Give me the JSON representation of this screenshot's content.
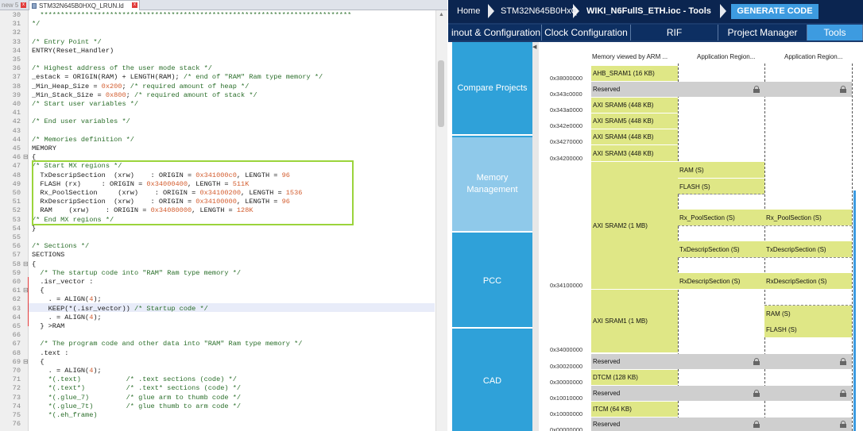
{
  "editor": {
    "prev_tab_label": "new 5",
    "active_tab_label": "STM32N645B0HXQ_LRUN.ld",
    "lines": [
      {
        "n": "30",
        "t": "  ****************************************************************************"
      },
      {
        "n": "31",
        "t": "*/"
      },
      {
        "n": "32",
        "t": ""
      },
      {
        "n": "33",
        "t": "/* Entry Point */"
      },
      {
        "n": "34",
        "t": "ENTRY(Reset_Handler)"
      },
      {
        "n": "35",
        "t": ""
      },
      {
        "n": "36",
        "t": "/* Highest address of the user mode stack */"
      },
      {
        "n": "37",
        "t": "_estack = ORIGIN(RAM) + LENGTH(RAM); /* end of \"RAM\" Ram type memory */"
      },
      {
        "n": "38",
        "t": "_Min_Heap_Size = 0x200; /* required amount of heap */"
      },
      {
        "n": "39",
        "t": "_Min_Stack_Size = 0x800; /* required amount of stack */"
      },
      {
        "n": "40",
        "t": "/* Start user variables */"
      },
      {
        "n": "41",
        "t": ""
      },
      {
        "n": "42",
        "t": "/* End user variables */"
      },
      {
        "n": "43",
        "t": ""
      },
      {
        "n": "44",
        "t": "/* Memories definition */"
      },
      {
        "n": "45",
        "t": "MEMORY"
      },
      {
        "n": "46",
        "t": "{"
      },
      {
        "n": "47",
        "t": "/* Start MX regions */"
      },
      {
        "n": "48",
        "t": "  TxDescripSection  (xrw)    : ORIGIN = 0x341000c0, LENGTH = 96"
      },
      {
        "n": "49",
        "t": "  FLASH (rx)     : ORIGIN = 0x34000400, LENGTH = 511K"
      },
      {
        "n": "50",
        "t": "  Rx_PoolSection     (xrw)    : ORIGIN = 0x34100200, LENGTH = 1536"
      },
      {
        "n": "51",
        "t": "  RxDescripSection  (xrw)    : ORIGIN = 0x34100000, LENGTH = 96"
      },
      {
        "n": "52",
        "t": "  RAM    (xrw)    : ORIGIN = 0x34080000, LENGTH = 128K"
      },
      {
        "n": "53",
        "t": "/* End MX regions */"
      },
      {
        "n": "54",
        "t": "}"
      },
      {
        "n": "55",
        "t": ""
      },
      {
        "n": "56",
        "t": "/* Sections */"
      },
      {
        "n": "57",
        "t": "SECTIONS"
      },
      {
        "n": "58",
        "t": "{"
      },
      {
        "n": "59",
        "t": "  /* The startup code into \"RAM\" Ram type memory */"
      },
      {
        "n": "60",
        "t": "  .isr_vector :"
      },
      {
        "n": "61",
        "t": "  {"
      },
      {
        "n": "62",
        "t": "    . = ALIGN(4);"
      },
      {
        "n": "63",
        "t": "    KEEP(*(.isr_vector)) /* Startup code */"
      },
      {
        "n": "64",
        "t": "    . = ALIGN(4);"
      },
      {
        "n": "65",
        "t": "  } >RAM"
      },
      {
        "n": "66",
        "t": ""
      },
      {
        "n": "67",
        "t": "  /* The program code and other data into \"RAM\" Ram type memory */"
      },
      {
        "n": "68",
        "t": "  .text :"
      },
      {
        "n": "69",
        "t": "  {"
      },
      {
        "n": "70",
        "t": "    . = ALIGN(4);"
      },
      {
        "n": "71",
        "t": "    *(.text)           /* .text sections (code) */"
      },
      {
        "n": "72",
        "t": "    *(.text*)          /* .text* sections (code) */"
      },
      {
        "n": "73",
        "t": "    *(.glue_7)         /* glue arm to thumb code */"
      },
      {
        "n": "74",
        "t": "    *(.glue_7t)        /* glue thumb to arm code */"
      },
      {
        "n": "75",
        "t": "    *(.eh_frame)"
      },
      {
        "n": "76",
        "t": ""
      }
    ]
  },
  "cube": {
    "breadcrumb": [
      "Home",
      "STM32N645B0HxQ",
      "WIKI_N6FullS_ETH.ioc - Tools"
    ],
    "generate_label": "GENERATE CODE",
    "tabs": [
      "inout & Configuration",
      "Clock Configuration",
      "RIF",
      "Project Manager",
      "Tools"
    ],
    "sidebar": [
      "Compare Projects",
      "Memory Management",
      "PCC",
      "CAD"
    ],
    "columns": [
      "Memory viewed by ARM ...",
      "Application Region...",
      "Application Region..."
    ],
    "addresses": [
      "0x38000000",
      "0x343c0000",
      "0x343a0000",
      "0x342e0000",
      "0x34270000",
      "0x34200000",
      "0x34100000",
      "0x34000000",
      "0x30020000",
      "0x30000000",
      "0x10010000",
      "0x10000000",
      "0x00000000"
    ],
    "regions": {
      "ahb_sram1": "AHB_SRAM1 (16 KB)",
      "reserved": "Reserved",
      "axi_sram6": "AXI SRAM6 (448 KB)",
      "axi_sram5": "AXI SRAM5 (448 KB)",
      "axi_sram4": "AXI SRAM4 (448 KB)",
      "axi_sram3": "AXI SRAM3 (448 KB)",
      "axi_sram2": "AXI SRAM2 (1 MB)",
      "axi_sram1": "AXI SRAM1 (1 MB)",
      "dtcm": "DTCM (128 KB)",
      "itcm": "ITCM (64 KB)"
    },
    "app_region1": {
      "ram": "RAM (S)",
      "flash": "FLASH (S)",
      "rx_pool": "Rx_PoolSection (S)",
      "tx_descrip": "TxDescripSection (S)",
      "rx_descrip": "RxDescripSection (S)"
    },
    "app_region2": {
      "rx_pool": "Rx_PoolSection (S)",
      "tx_descrip": "TxDescripSection (S)",
      "rx_descrip": "RxDescripSection (S)",
      "ram": "RAM (S)",
      "flash": "FLASH (S)"
    }
  }
}
